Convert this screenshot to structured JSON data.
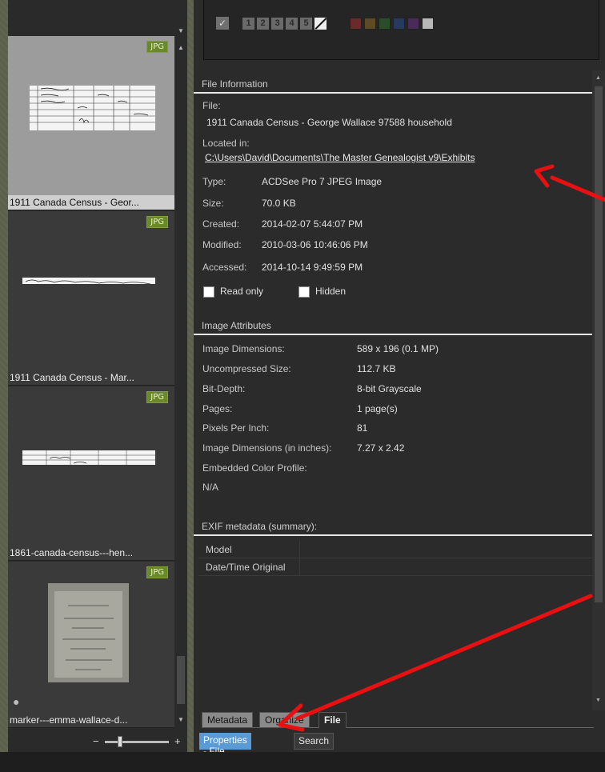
{
  "thumbnails": [
    {
      "caption": "1911 Canada Census - Geor...",
      "badge": "JPG",
      "selected": true
    },
    {
      "caption": "1911 Canada Census - Mar...",
      "badge": "JPG",
      "selected": false
    },
    {
      "caption": "1861-canada-census---hen...",
      "badge": "JPG",
      "selected": false
    },
    {
      "caption": "marker---emma-wallace-d...",
      "badge": "JPG",
      "selected": false
    }
  ],
  "zoom": {
    "minus": "−",
    "plus": "+"
  },
  "toolbar": {
    "check": "✓",
    "ratings": [
      "1",
      "2",
      "3",
      "4",
      "5"
    ],
    "color_labels": [
      "#6a2a2a",
      "#5e4a25",
      "#2a4e2a",
      "#253a5e",
      "#4a2a58",
      "#b8b8b8"
    ]
  },
  "file_information": {
    "title": "File Information",
    "file_label": "File:",
    "file_name": "1911 Canada Census - George Wallace 97588 household",
    "located_label": "Located in:",
    "located_path": "C:\\Users\\David\\Documents\\The Master Genealogist v9\\Exhibits",
    "type_label": "Type:",
    "type_value": "ACDSee Pro 7 JPEG Image",
    "size_label": "Size:",
    "size_value": "70.0 KB",
    "created_label": "Created:",
    "created_value": "2014-02-07 5:44:07 PM",
    "modified_label": "Modified:",
    "modified_value": "2010-03-06 10:46:06 PM",
    "accessed_label": "Accessed:",
    "accessed_value": "2014-10-14 9:49:59 PM",
    "readonly_label": "Read only",
    "hidden_label": "Hidden"
  },
  "image_attributes": {
    "title": "Image Attributes",
    "dimensions_label": "Image Dimensions:",
    "dimensions_value": "589 x 196 (0.1 MP)",
    "uncompressed_label": "Uncompressed Size:",
    "uncompressed_value": "112.7 KB",
    "bitdepth_label": "Bit-Depth:",
    "bitdepth_value": "8-bit Grayscale",
    "pages_label": "Pages:",
    "pages_value": "1 page(s)",
    "ppi_label": "Pixels Per Inch:",
    "ppi_value": "81",
    "inches_label": "Image Dimensions (in inches):",
    "inches_value": "7.27 x 2.42",
    "profile_label": "Embedded Color Profile:",
    "profile_value": "N/A"
  },
  "exif": {
    "title": "EXIF metadata (summary):",
    "rows": [
      "Model",
      "Date/Time Original"
    ]
  },
  "tabs": [
    "Metadata",
    "Organize",
    "File"
  ],
  "bottom_buttons": {
    "properties": "Properties - File",
    "search": "Search"
  },
  "colors": {
    "accent": "#5b9bd5",
    "arrow": "#e81010",
    "badge": "#6a8a2a"
  }
}
